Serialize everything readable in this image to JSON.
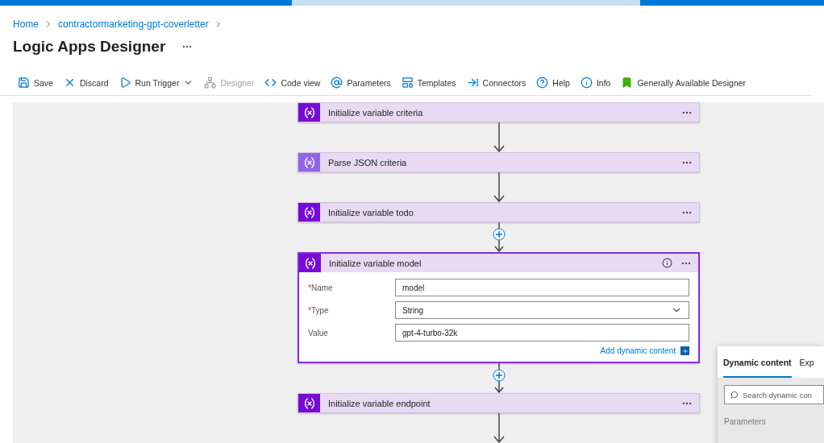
{
  "breadcrumb": [
    {
      "label": "Home"
    },
    {
      "label": "contractormarketing-gpt-coverletter"
    }
  ],
  "page_title": "Logic Apps Designer",
  "toolbar": [
    {
      "label": "Save",
      "disabled": false,
      "dropdown": false
    },
    {
      "label": "Discard",
      "disabled": false,
      "dropdown": false
    },
    {
      "label": "Run Trigger",
      "disabled": false,
      "dropdown": true
    },
    {
      "label": "Designer",
      "disabled": true,
      "dropdown": false
    },
    {
      "label": "Code view",
      "disabled": false,
      "dropdown": false
    },
    {
      "label": "Parameters",
      "disabled": false,
      "dropdown": false
    },
    {
      "label": "Templates",
      "disabled": false,
      "dropdown": false
    },
    {
      "label": "Connectors",
      "disabled": false,
      "dropdown": false
    },
    {
      "label": "Help",
      "disabled": false,
      "dropdown": false
    },
    {
      "label": "Info",
      "disabled": false,
      "dropdown": false
    },
    {
      "label": "Generally Available Designer",
      "disabled": false,
      "dropdown": false
    }
  ],
  "flow": [
    {
      "kind": "variable",
      "title": "Initialize variable criteria",
      "expanded": false
    },
    {
      "kind": "arrow"
    },
    {
      "kind": "parse",
      "title": "Parse JSON criteria",
      "expanded": false
    },
    {
      "kind": "arrow"
    },
    {
      "kind": "variable",
      "title": "Initialize variable todo",
      "expanded": false
    },
    {
      "kind": "add"
    },
    {
      "kind": "variable",
      "title": "Initialize variable model",
      "expanded": true,
      "fields": [
        {
          "label": "Name",
          "required_mark": "*",
          "kind": "text",
          "value": "model"
        },
        {
          "label": "Type",
          "required_mark": "*",
          "kind": "select",
          "value": "String"
        },
        {
          "label": "Value",
          "kind": "text",
          "value": "gpt-4-turbo-32k"
        }
      ],
      "add_dynamic": "Add dynamic content"
    },
    {
      "kind": "add"
    },
    {
      "kind": "variable",
      "title": "Initialize variable endpoint",
      "expanded": false
    },
    {
      "kind": "arrow"
    }
  ],
  "dynamic_panel": {
    "tabs": [
      {
        "label": "Dynamic content",
        "selected": true
      },
      {
        "label": "Exp",
        "selected": false
      }
    ],
    "search": {
      "placeholder": "Search dynamic con"
    },
    "section": "Parameters"
  }
}
